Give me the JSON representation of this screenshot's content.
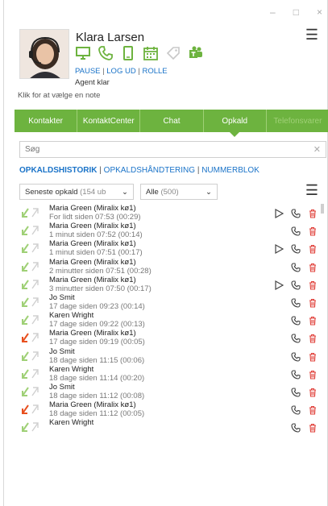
{
  "window_controls": {
    "minimize": "–",
    "maximize": "□",
    "close": "×"
  },
  "agent": {
    "name": "Klara Larsen",
    "links": {
      "pause": "PAUSE",
      "logout": "LOG UD",
      "role": "ROLLE"
    },
    "status": "Agent klar",
    "note_placeholder": "Klik for at vælge en note"
  },
  "tabs": [
    {
      "label": "Kontakter"
    },
    {
      "label": "KontaktCenter"
    },
    {
      "label": "Chat"
    },
    {
      "label": "Opkald"
    },
    {
      "label": "Telefonsvarer"
    }
  ],
  "search": {
    "placeholder": "Søg"
  },
  "subnav": {
    "history": "OPKALDSHISTORIK",
    "handling": "OPKALDSHÅNDTERING",
    "numpad": "NUMMERBLOK"
  },
  "filters": {
    "recent_label": "Seneste opkald",
    "recent_count": "(154 ub",
    "all_label": "Alle",
    "all_count": "(500)"
  },
  "colors": {
    "accent_green": "#6db33f",
    "link_blue": "#1a73c8",
    "missed_red": "#e8501f",
    "delete_red": "#e0403a"
  },
  "calls": [
    {
      "name": "Maria Green (Miralix kø1)",
      "time": "For lidt siden 07:53 (00:29)",
      "missed": false,
      "play": true
    },
    {
      "name": "Maria Green (Miralix kø1)",
      "time": "1 minut siden 07:52 (00:14)",
      "missed": false,
      "play": false
    },
    {
      "name": "Maria Green (Miralix kø1)",
      "time": "1 minut siden 07:51 (00:17)",
      "missed": false,
      "play": true
    },
    {
      "name": "Maria Green (Miralix kø1)",
      "time": "2 minutter siden 07:51 (00:28)",
      "missed": false,
      "play": false
    },
    {
      "name": "Maria Green (Miralix kø1)",
      "time": "3 minutter siden 07:50 (00:17)",
      "missed": false,
      "play": true
    },
    {
      "name": "Jo Smit",
      "time": "17 dage siden 09:23 (00:14)",
      "missed": false,
      "play": false
    },
    {
      "name": "Karen Wright",
      "time": "17 dage siden 09:22 (00:13)",
      "missed": false,
      "play": false
    },
    {
      "name": "Maria Green (Miralix kø1)",
      "time": "17 dage siden 09:19 (00:05)",
      "missed": true,
      "play": false
    },
    {
      "name": "Jo Smit",
      "time": "18 dage siden 11:15 (00:06)",
      "missed": false,
      "play": false
    },
    {
      "name": "Karen Wright",
      "time": "18 dage siden 11:14 (00:20)",
      "missed": false,
      "play": false
    },
    {
      "name": "Jo Smit",
      "time": "18 dage siden 11:12 (00:08)",
      "missed": false,
      "play": false
    },
    {
      "name": "Maria Green (Miralix kø1)",
      "time": "18 dage siden 11:12 (00:05)",
      "missed": true,
      "play": false
    },
    {
      "name": "Karen Wright",
      "time": "",
      "missed": false,
      "play": false
    }
  ]
}
